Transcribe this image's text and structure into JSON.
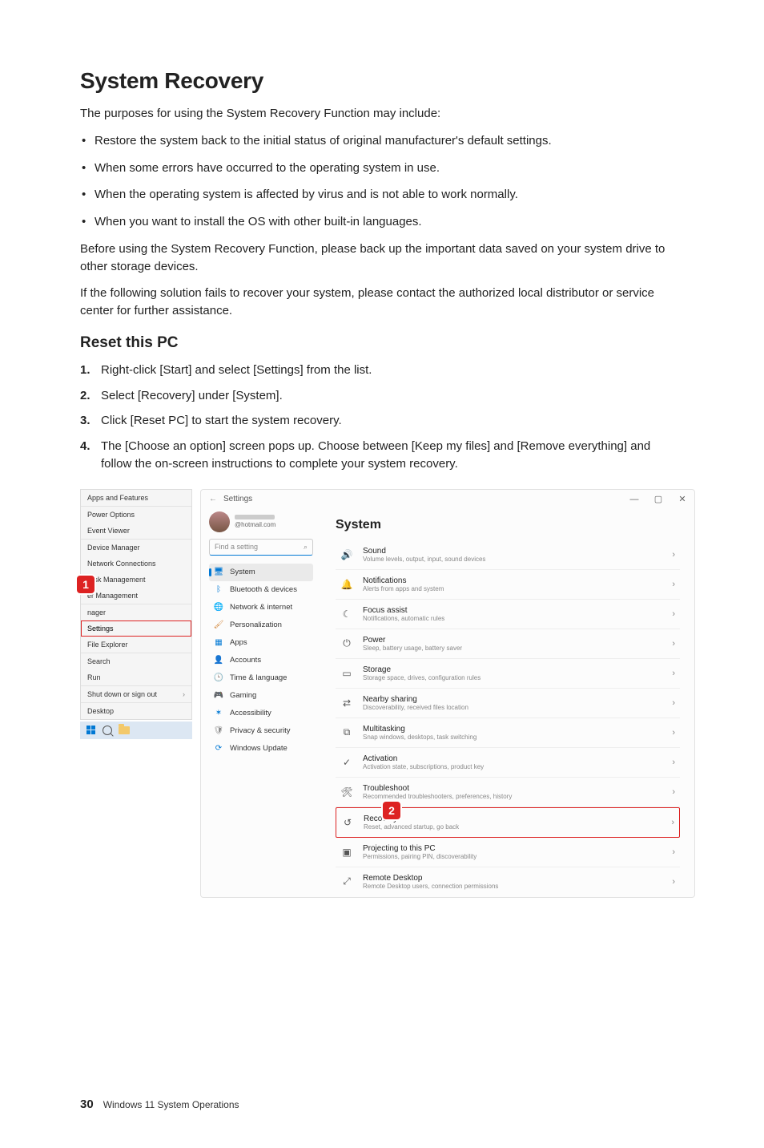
{
  "page": {
    "title": "System Recovery",
    "intro": "The purposes for using the System Recovery Function may include:",
    "bullets": [
      "Restore the system back to the initial status of original manufacturer's default settings.",
      "When some errors have occurred to the operating system in use.",
      "When the operating system is affected by virus and is not able to work normally.",
      "When you want to install the OS with other built-in languages."
    ],
    "para1": "Before using the System Recovery Function, please back up the important data saved on your system drive to other storage devices.",
    "para2": "If the following solution fails to recover your system, please contact the authorized local distributor or service center for further assistance.",
    "section_title": "Reset this PC",
    "steps": [
      "Right-click [Start] and select [Settings] from the list.",
      "Select [Recovery] under [System].",
      "Click [Reset PC] to start the system recovery.",
      "The [Choose an option] screen pops up. Choose between [Keep my files] and [Remove everything] and follow the on-screen instructions to complete your system recovery."
    ]
  },
  "context_menu": {
    "items": [
      "Apps and Features",
      "Power Options",
      "Event Viewer",
      "Device Manager",
      "Network Connections",
      "Disk Management",
      "er Management",
      "nager",
      "Settings",
      "File Explorer",
      "Search",
      "Run",
      "Shut down or sign out",
      "Desktop"
    ],
    "highlight_index": 8
  },
  "settings": {
    "win_title": "Settings",
    "user_email": "@hotmail.com",
    "search_placeholder": "Find a setting",
    "nav": [
      {
        "icon": "🖥",
        "label": "System",
        "color": "#0078d4",
        "selected": true
      },
      {
        "icon": "ᛒ",
        "label": "Bluetooth & devices",
        "color": "#0078d4"
      },
      {
        "icon": "🌐",
        "label": "Network & internet",
        "color": "#0078d4"
      },
      {
        "icon": "🖌",
        "label": "Personalization",
        "color": "#d08030"
      },
      {
        "icon": "▦",
        "label": "Apps",
        "color": "#0078d4"
      },
      {
        "icon": "👤",
        "label": "Accounts",
        "color": "#2e8b57"
      },
      {
        "icon": "🕒",
        "label": "Time & language",
        "color": "#0078d4"
      },
      {
        "icon": "🎮",
        "label": "Gaming",
        "color": "#555"
      },
      {
        "icon": "✶",
        "label": "Accessibility",
        "color": "#0078d4"
      },
      {
        "icon": "🛡",
        "label": "Privacy & security",
        "color": "#888"
      },
      {
        "icon": "⟳",
        "label": "Windows Update",
        "color": "#0078d4"
      }
    ],
    "main_title": "System",
    "rows": [
      {
        "icon": "🔊",
        "title": "Sound",
        "sub": "Volume levels, output, input, sound devices"
      },
      {
        "icon": "🔔",
        "title": "Notifications",
        "sub": "Alerts from apps and system"
      },
      {
        "icon": "☾",
        "title": "Focus assist",
        "sub": "Notifications, automatic rules"
      },
      {
        "icon": "⏻",
        "title": "Power",
        "sub": "Sleep, battery usage, battery saver"
      },
      {
        "icon": "▭",
        "title": "Storage",
        "sub": "Storage space, drives, configuration rules"
      },
      {
        "icon": "⇄",
        "title": "Nearby sharing",
        "sub": "Discoverability, received files location"
      },
      {
        "icon": "⧉",
        "title": "Multitasking",
        "sub": "Snap windows, desktops, task switching"
      },
      {
        "icon": "✓",
        "title": "Activation",
        "sub": "Activation state, subscriptions, product key"
      },
      {
        "icon": "🛠",
        "title": "Troubleshoot",
        "sub": "Recommended troubleshooters, preferences, history"
      },
      {
        "icon": "↺",
        "title": "Recovery",
        "sub": "Reset, advanced startup, go back",
        "highlight": true
      },
      {
        "icon": "▣",
        "title": "Projecting to this PC",
        "sub": "Permissions, pairing PIN, discoverability"
      },
      {
        "icon": "⤢",
        "title": "Remote Desktop",
        "sub": "Remote Desktop users, connection permissions"
      }
    ]
  },
  "callouts": {
    "one": "1",
    "two": "2"
  },
  "footer": {
    "page_number": "30",
    "text": "Windows 11 System Operations"
  }
}
